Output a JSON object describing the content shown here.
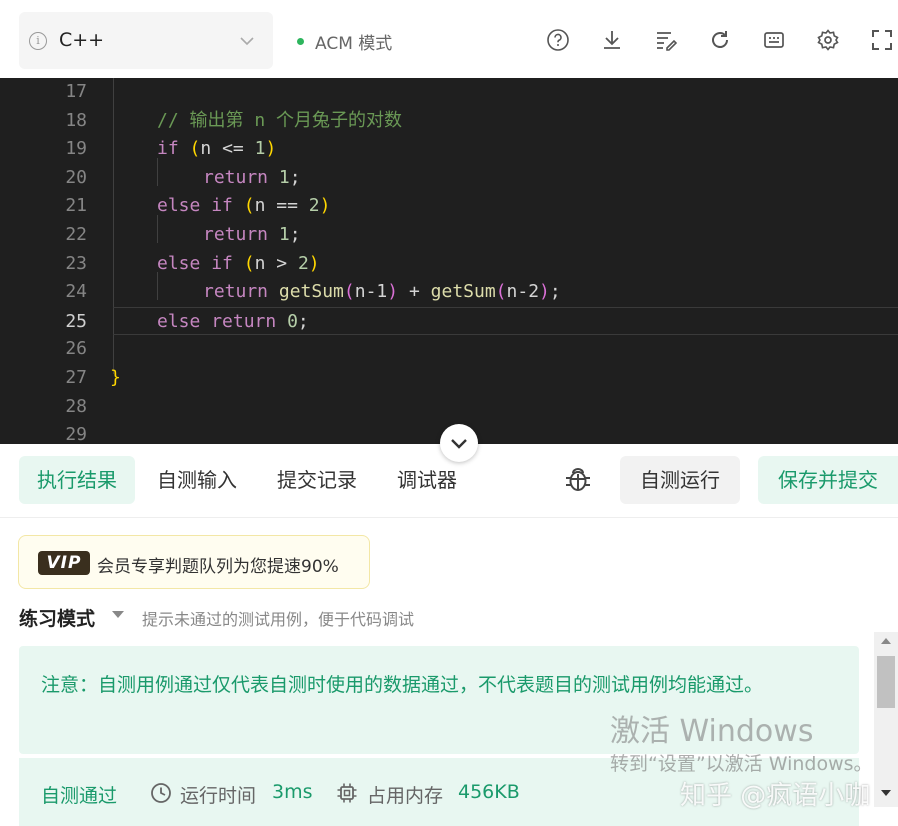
{
  "toolbar": {
    "language": "C++",
    "mode_label": "ACM 模式",
    "icons": [
      "help-icon",
      "download-icon",
      "format-icon",
      "reset-icon",
      "shortcut-icon",
      "settings-icon",
      "fullscreen-icon"
    ]
  },
  "editor": {
    "lines": [
      {
        "no": "17"
      },
      {
        "no": "18"
      },
      {
        "no": "19"
      },
      {
        "no": "20"
      },
      {
        "no": "21"
      },
      {
        "no": "22"
      },
      {
        "no": "23"
      },
      {
        "no": "24"
      },
      {
        "no": "25"
      },
      {
        "no": "26"
      },
      {
        "no": "27"
      },
      {
        "no": "28"
      },
      {
        "no": "29"
      }
    ],
    "active_line": "25",
    "code": {
      "comment": "// 输出第 n 个月兔子的对数",
      "kw_if": "if",
      "kw_else": "else",
      "kw_return": "return",
      "var_n": "n",
      "op_le": "<=",
      "op_eq": "==",
      "op_gt": ">",
      "num_0": "0",
      "num_1": "1",
      "num_2": "2",
      "fn_getsum": "getSum",
      "n_minus_1": "n-1",
      "n_minus_2": "n-2",
      "plus": "+",
      "semicolon": ";",
      "open_paren": "(",
      "close_paren": ")",
      "close_brace": "}"
    }
  },
  "tabs": {
    "items": [
      {
        "label": "执行结果"
      },
      {
        "label": "自测输入"
      },
      {
        "label": "提交记录"
      },
      {
        "label": "调试器"
      }
    ],
    "run_label": "自测运行",
    "submit_label": "保存并提交"
  },
  "vip": {
    "badge": "VIP",
    "text": "会员专享判题队列为您提速90%"
  },
  "practice": {
    "title": "练习模式",
    "hint": "提示未通过的测试用例，便于代码调试"
  },
  "notice": {
    "text": "注意：自测用例通过仅代表自测时使用的数据通过，不代表题目的测试用例均能通过。"
  },
  "result": {
    "status": "自测通过",
    "time_label": "运行时间",
    "time_value": "3ms",
    "memory_label": "占用内存",
    "memory_value": "456KB"
  },
  "watermarks": {
    "activate_title": "激活 Windows",
    "activate_sub": "转到“设置”以激活 Windows。",
    "zhihu": "知乎 @疯语小咖"
  },
  "colors": {
    "accent": "#1a9a6b",
    "accent_bg": "#e8f7f1",
    "editor_bg": "#1f1f1f"
  }
}
